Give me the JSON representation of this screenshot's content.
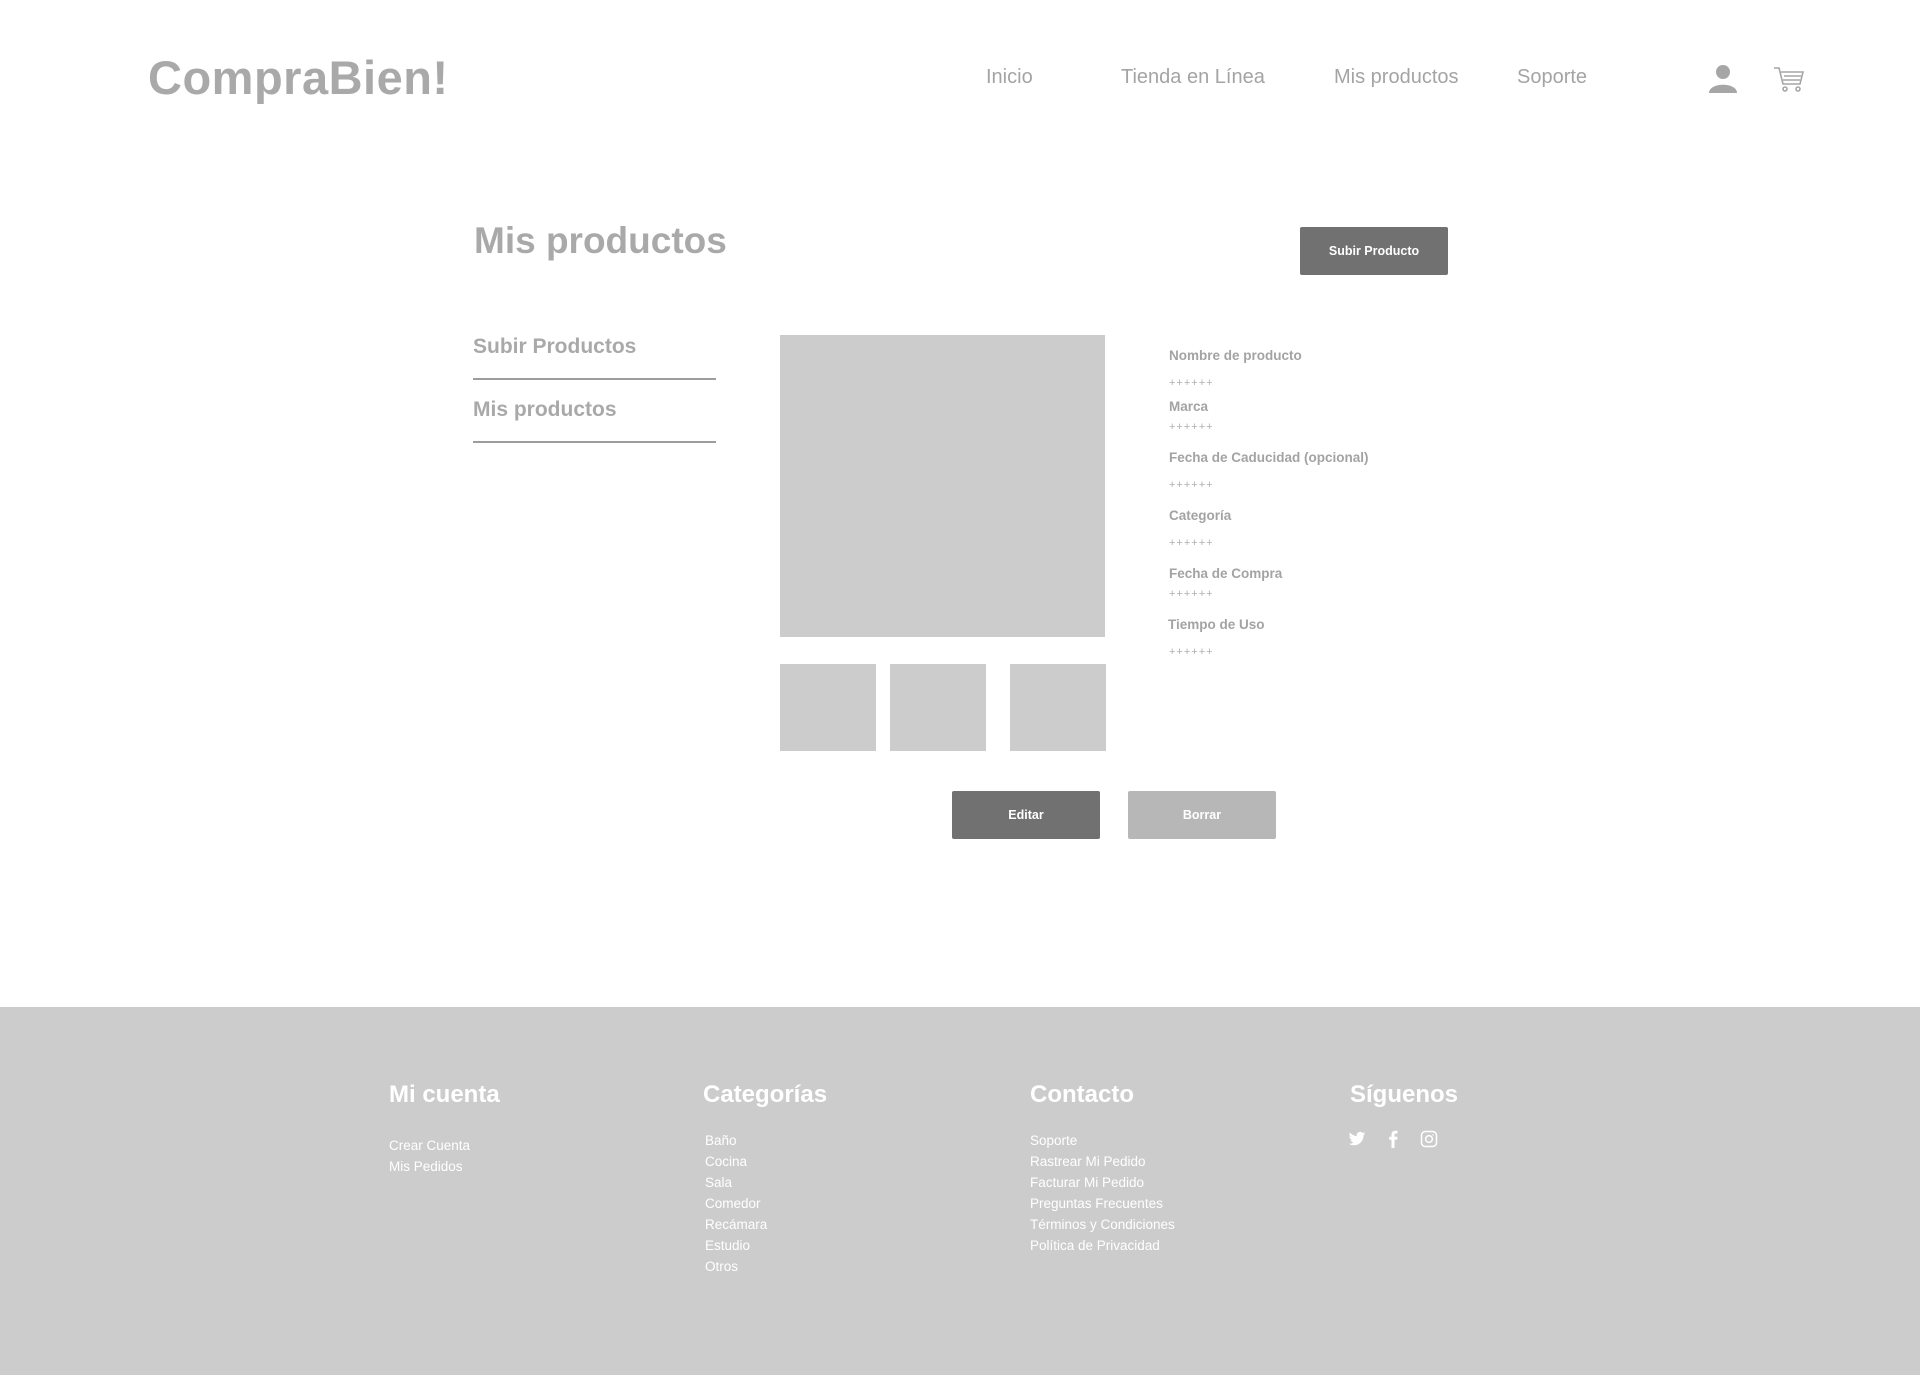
{
  "header": {
    "logo": "CompraBien!",
    "nav": [
      "Inicio",
      "Tienda en Línea",
      "Mis productos",
      "Soporte"
    ],
    "icons": [
      "user-icon",
      "cart-icon"
    ]
  },
  "main": {
    "title": "Mis productos",
    "upload_button": "Subir Producto",
    "side_menu": [
      "Subir Productos",
      "Mis productos"
    ],
    "details": [
      {
        "label": "Nombre de producto",
        "value": "++++++"
      },
      {
        "label": "Marca",
        "value": "++++++"
      },
      {
        "label": "Fecha de Caducidad (opcional)",
        "value": "++++++"
      },
      {
        "label": "Categoría",
        "value": "++++++"
      },
      {
        "label": "Fecha de Compra",
        "value": "++++++"
      },
      {
        "label": "Tiempo de Uso",
        "value": "++++++"
      }
    ],
    "edit_button": "Editar",
    "delete_button": "Borrar"
  },
  "footer": {
    "account": {
      "title": "Mi cuenta",
      "links": [
        "Crear Cuenta",
        "Mis Pedidos"
      ]
    },
    "categories": {
      "title": "Categorías",
      "links": [
        "Baño",
        "Cocina",
        "Sala",
        "Comedor",
        "Recámara",
        "Estudio",
        "Otros"
      ]
    },
    "contact": {
      "title": "Contacto",
      "links": [
        "Soporte",
        "Rastrear Mi Pedido",
        "Facturar Mi Pedido",
        "Preguntas Frecuentes",
        "Términos y Condiciones",
        "Política de Privacidad"
      ]
    },
    "follow": {
      "title": "Síguenos",
      "icons": [
        "twitter-icon",
        "facebook-icon",
        "instagram-icon"
      ]
    }
  },
  "colors": {
    "dark_button": "#717171",
    "light_button": "#b7b7b7",
    "placeholder": "#cccccc",
    "footer_bg": "#cccccc"
  }
}
